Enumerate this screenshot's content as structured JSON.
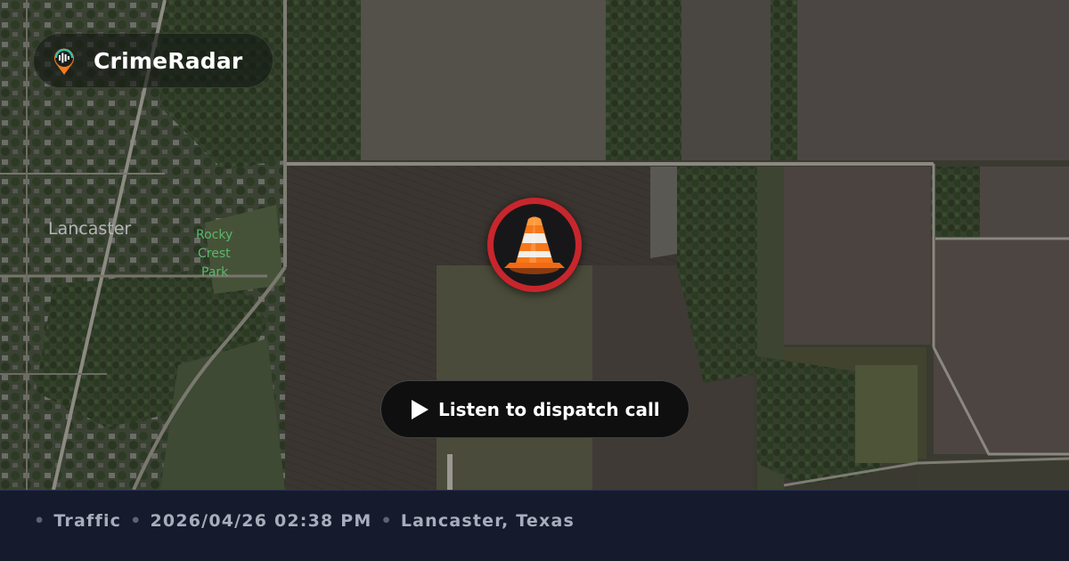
{
  "brand": {
    "name": "CrimeRadar",
    "logo_icon": "radar-pin-icon"
  },
  "map": {
    "place_labels": [
      "Lancaster",
      "Rocky",
      "Crest",
      "Park"
    ]
  },
  "incident": {
    "icon": "traffic-cone-icon",
    "marker_color": "#c8262c"
  },
  "cta": {
    "label": "Listen to dispatch call",
    "icon": "play-icon"
  },
  "footer": {
    "category": "Traffic",
    "datetime": "2026/04/26 02:38 PM",
    "location": "Lancaster, Texas",
    "separator": "•"
  }
}
